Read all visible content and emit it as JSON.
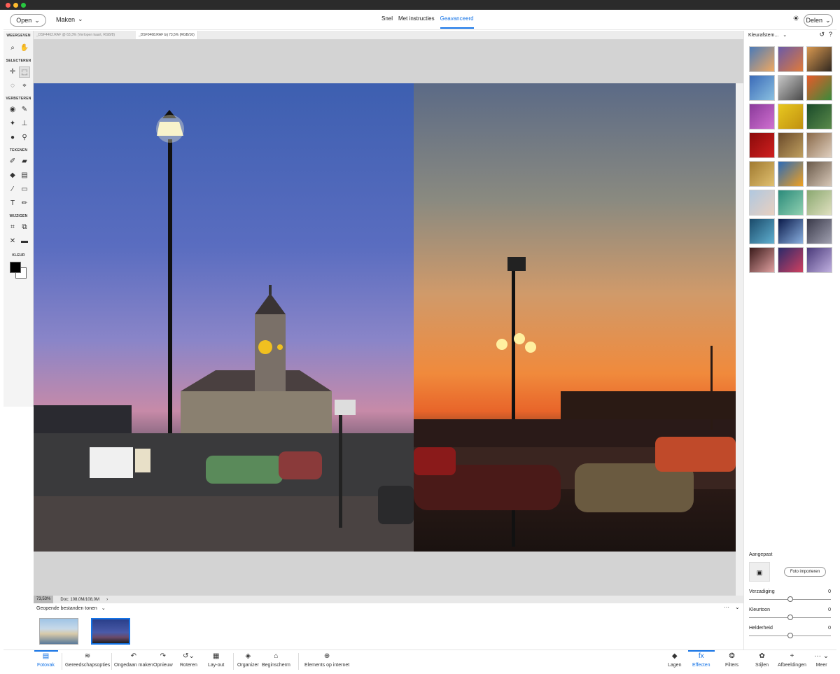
{
  "topbar": {
    "open_label": "Open",
    "maken_label": "Maken",
    "modes": [
      "Snel",
      "Met instructies",
      "Geavanceerd"
    ],
    "share_label": "Delen"
  },
  "toolbox": {
    "sections": [
      "WEERGEVEN",
      "SELECTEREN",
      "VERBETEREN",
      "TEKENEN",
      "WIJZIGEN",
      "KLEUR"
    ]
  },
  "document": {
    "tabs": [
      "_DSF4462.RAF @ 63,3% (Verlopen kaart, RGB/8)",
      "_DSF0468.RAF bij 73,5% (RGB/16)"
    ],
    "zoom": "73,53%",
    "doc_info": "Doc: 108,0M/108,0M"
  },
  "photobin": {
    "label": "Geopende bestanden tonen"
  },
  "bottombar": {
    "left": [
      "Fotovak",
      "Gereedschapsopties",
      "Ongedaan maken",
      "Opnieuw",
      "Roteren",
      "Lay-out",
      "Organizer",
      "Beginscherm",
      "Elements op internet"
    ],
    "right": [
      "Lagen",
      "Effecten",
      "Filters",
      "Stijlen",
      "Afbeeldingen",
      "Meer"
    ]
  },
  "panel": {
    "title": "Kleurafstem...",
    "custom_label": "Aangepast",
    "import_label": "Foto importeren",
    "sliders": [
      {
        "label": "Verzadiging",
        "value": "0",
        "level": 0.5
      },
      {
        "label": "Kleurtoon",
        "value": "0",
        "level": 0.5
      },
      {
        "label": "Helderheid",
        "value": "0",
        "level": 0.5
      }
    ],
    "effect_colors": [
      [
        "#4a7ab8",
        "#f0a860"
      ],
      [
        "#6a5aa8",
        "#e07a3a"
      ],
      [
        "#d89850",
        "#302820"
      ],
      [
        "#3a6ab8",
        "#8ac0e0"
      ],
      [
        "#c8c8c8",
        "#4a4a4a"
      ],
      [
        "#e85a2a",
        "#3a8a3a"
      ],
      [
        "#8a3a9a",
        "#d070d0"
      ],
      [
        "#e8c820",
        "#c09010"
      ],
      [
        "#1a4a2a",
        "#5a8a4a"
      ],
      [
        "#8a0a0a",
        "#d02020"
      ],
      [
        "#6a4a2a",
        "#c0a060"
      ],
      [
        "#8a6a4a",
        "#e0d0c0"
      ],
      [
        "#a07a30",
        "#e0c070"
      ],
      [
        "#2a6ab8",
        "#f0a020"
      ],
      [
        "#6a5a4a",
        "#d8c8b8"
      ],
      [
        "#b0c8e0",
        "#e8d0c0"
      ],
      [
        "#2a8a7a",
        "#90d0b0"
      ],
      [
        "#8aa870",
        "#e0e0c0"
      ],
      [
        "#1a4a6a",
        "#60b0d0"
      ],
      [
        "#0a1a4a",
        "#8ab0e0"
      ],
      [
        "#3a3a4a",
        "#a0a0b0"
      ],
      [
        "#3a1a1a",
        "#e0a0a0"
      ],
      [
        "#2a2a6a",
        "#d04060"
      ],
      [
        "#4a3a7a",
        "#c0b0e0"
      ]
    ]
  }
}
